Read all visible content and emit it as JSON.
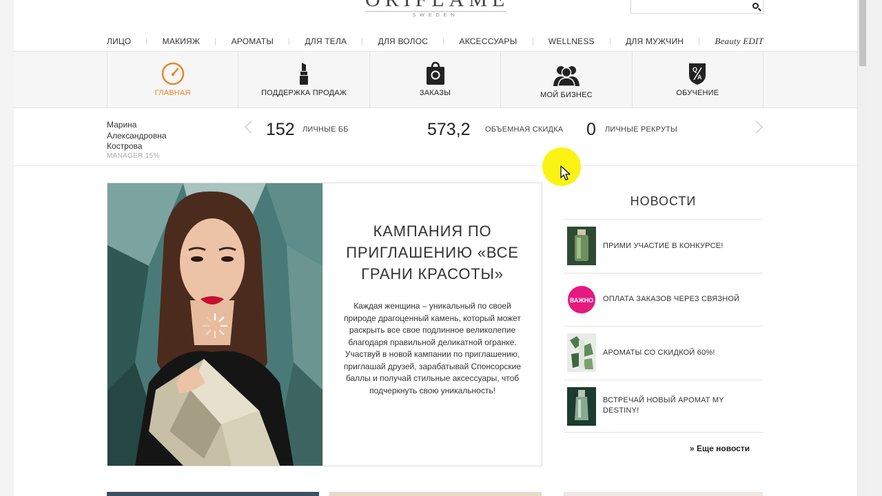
{
  "header": {
    "logo_main": "ORIFLAME",
    "logo_sub": "SWEDEN"
  },
  "nav": {
    "items": [
      "ЛИЦО",
      "МАКИЯЖ",
      "АРОМАТЫ",
      "ДЛЯ ТЕЛА",
      "ДЛЯ ВОЛОС",
      "АКСЕССУАРЫ",
      "WELLNESS",
      "ДЛЯ МУЖЧИН",
      "Beauty EDIT"
    ]
  },
  "tabs": {
    "items": [
      {
        "label": "ГЛАВНАЯ",
        "icon": "gauge-icon",
        "active": true
      },
      {
        "label": "ПОДДЕРЖКА ПРОДАЖ",
        "icon": "lipstick-icon",
        "active": false
      },
      {
        "label": "ЗАКАЗЫ",
        "icon": "shopping-bag-icon",
        "active": false
      },
      {
        "label": "МОЙ БИЗНЕС",
        "icon": "team-icon",
        "active": false
      },
      {
        "label": "ОБУЧЕНИЕ",
        "icon": "qa-shield-icon",
        "active": false
      }
    ],
    "accent_color": "#e8862d"
  },
  "user": {
    "name_line1": "Марина",
    "name_line2": "Александровна",
    "name_line3": "Кострова",
    "rank": "MANAGER 15%"
  },
  "stats": {
    "personal_bp_value": "152",
    "personal_bp_label": "ЛИЧНЫЕ ББ",
    "volume_discount_value": "573,2",
    "volume_discount_label": "ОБЪЕМНАЯ СКИДКА",
    "recruits_value": "0",
    "recruits_label": "ЛИЧНЫЕ РЕКРУТЫ"
  },
  "promo": {
    "title": "КАМПАНИЯ ПО ПРИГЛАШЕНИЮ «ВСЕ ГРАНИ КРАСОТЫ»",
    "body": "Каждая женщина – уникальный по своей природе драгоценный камень, который может раскрыть все свое подлинное великолепие благодаря правильной деликатной огранке. Участвуй в новой кампании по приглашению, приглашай друзей, зарабатывай Спонсорские баллы и получай стильные аксессуары, чтоб подчеркнуть свою уникальность!"
  },
  "news": {
    "title": "НОВОСТИ",
    "items": [
      {
        "text": "ПРИМИ УЧАСТИЕ В КОНКУРСЕ!"
      },
      {
        "text": "ОПЛАТА ЗАКАЗОВ ЧЕРЕЗ СВЯЗНОЙ",
        "badge": "ВАЖНО"
      },
      {
        "text": "АРОМАТЫ СО СКИДКОЙ 60%!"
      },
      {
        "text": "ВСТРЕЧАЙ НОВЫЙ АРОМАТ MY DESTINY!"
      }
    ],
    "more_label": "» Еще новости"
  }
}
